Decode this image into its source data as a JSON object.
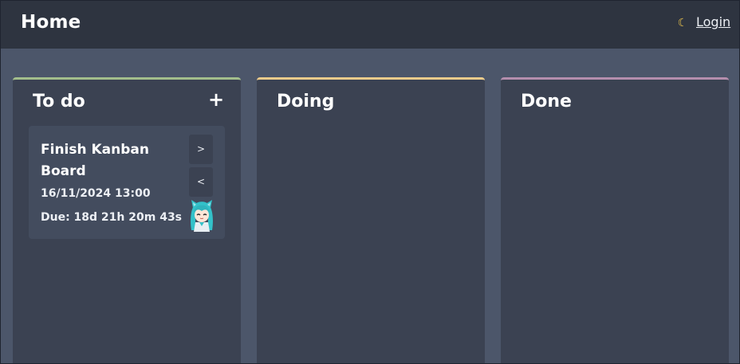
{
  "header": {
    "title": "Home",
    "theme_icon": "moon-icon",
    "login_label": "Login"
  },
  "columns": [
    {
      "title": "To do",
      "accent": "#a3be8c",
      "add_label": "+",
      "cards": [
        {
          "title": "Finish Kanban Board",
          "date": "16/11/2024 13:00",
          "due": "Due: 18d 21h 20m 43s",
          "move_right_label": ">",
          "move_left_label": "<",
          "avatar_icon": "anime-avatar-icon"
        }
      ]
    },
    {
      "title": "Doing",
      "accent": "#ebcb8b",
      "cards": []
    },
    {
      "title": "Done",
      "accent": "#b48ead",
      "cards": []
    }
  ]
}
